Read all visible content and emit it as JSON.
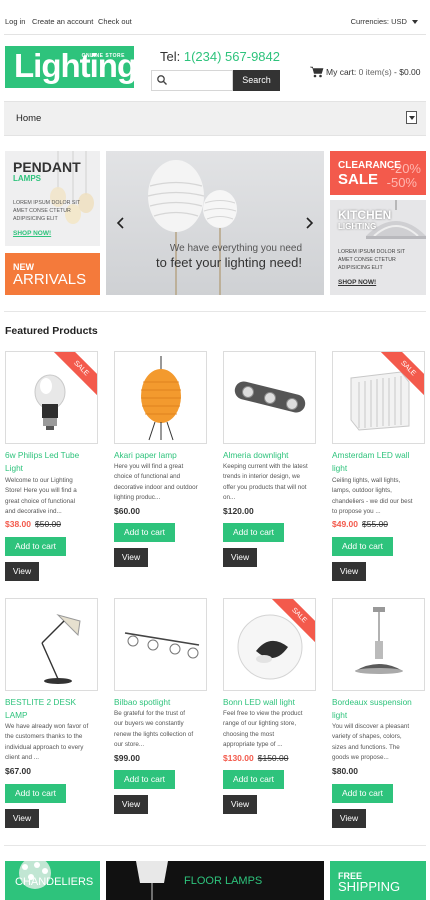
{
  "topbar": {
    "links": [
      "Log in",
      "Create an account",
      "Check out"
    ],
    "currency_label": "Currencies:",
    "currency_value": "USD"
  },
  "header": {
    "logo_text": "Lighting",
    "logo_sub": "ONLINE STORE",
    "tel_label": "Tel:",
    "tel_number": "1(234) 567-9842",
    "search_placeholder": "",
    "search_button": "Search",
    "cart_label": "My cart:",
    "cart_count": "0 item(s)",
    "cart_total": "- $0.00"
  },
  "nav": {
    "home": "Home"
  },
  "banners": {
    "pendant": {
      "title": "PENDANT",
      "subtitle": "LAMPS",
      "text": [
        "LOREM IPSUM DOLOR SIT",
        "AMET CONSE CTETUR",
        "ADIPISICING ELIT"
      ],
      "link": "SHOP NOW!"
    },
    "arrivals": {
      "line1": "NEW",
      "line2": "ARRIVALS"
    },
    "slider": {
      "caption1": "We have everything you need",
      "caption2": "to feet your lighting need!"
    },
    "clearance": {
      "line1": "CLEARANCE",
      "line2": "SALE",
      "pct1": "-20%",
      "pct2": "-50%"
    },
    "kitchen": {
      "title": "KITCHEN",
      "subtitle": "LIGHTING",
      "text": [
        "LOREM IPSUM DOLOR SIT",
        "AMET CONSE CTETUR",
        "ADIPISICING ELIT"
      ],
      "link": "SHOP NOW!"
    }
  },
  "featured": {
    "title": "Featured Products",
    "add_to_cart": "Add to cart",
    "view": "View",
    "sale": "SALE",
    "products": [
      {
        "name": [
          "6w Philips Led Tube",
          "Light"
        ],
        "desc": [
          "Welcome to our Lighting",
          "Store! Here you will find a",
          "great choice of functional",
          "and decorative ind..."
        ],
        "price": "$38.00",
        "old_price": "$50.00",
        "sale": true,
        "icon": "bulb-icon"
      },
      {
        "name": [
          "Akari paper lamp"
        ],
        "desc": [
          "Here you will find a great",
          "choice of functional and",
          "decorative indoor and outdoor",
          "lighting produc..."
        ],
        "price": "$60.00",
        "old_price": "",
        "sale": false,
        "icon": "paper-lamp-icon"
      },
      {
        "name": [
          "Almeria downlight"
        ],
        "desc": [
          "Keeping current with the latest",
          "trends in interior design, we",
          "offer you products that will not",
          "on..."
        ],
        "price": "$120.00",
        "old_price": "",
        "sale": false,
        "icon": "downlight-icon"
      },
      {
        "name": [
          "Amsterdam LED wall",
          "light"
        ],
        "desc": [
          "Ceiling lights, wall lights,",
          "lamps, outdoor lights,",
          "chandeliers - we did our best",
          "to propose you ..."
        ],
        "price": "$49.00",
        "old_price": "$55.00",
        "sale": true,
        "icon": "wall-light-icon"
      },
      {
        "name": [
          "BESTLITE 2 DESK",
          "LAMP"
        ],
        "desc": [
          "We have already won favor of",
          "the customers thanks to the",
          "individual approach to every",
          "client and ..."
        ],
        "price": "$67.00",
        "old_price": "",
        "sale": false,
        "icon": "desk-lamp-icon"
      },
      {
        "name": [
          "Bilbao spotlight"
        ],
        "desc": [
          "Be grateful for the trust of",
          "our buyers we constantly",
          "renew the lights collection of",
          "our store..."
        ],
        "price": "$99.00",
        "old_price": "",
        "sale": false,
        "icon": "spotlight-icon"
      },
      {
        "name": [
          "Bonn LED wall light"
        ],
        "desc": [
          "Feel free to view the product",
          "range of our lighting store,",
          "choosing the most",
          "appropriate type of ..."
        ],
        "price": "$130.00",
        "old_price": "$150.00",
        "sale": true,
        "icon": "globe-wall-light-icon"
      },
      {
        "name": [
          "Bordeaux suspension",
          "light"
        ],
        "desc": [
          "You will discover a pleasant",
          "variety of shapes, colors,",
          "sizes and functions. The",
          "goods we propose..."
        ],
        "price": "$80.00",
        "old_price": "",
        "sale": false,
        "icon": "suspension-light-icon"
      }
    ]
  },
  "bottom_banners": {
    "chandeliers": "CHANDELIERS",
    "floor_lamps": "FLOOR LAMPS",
    "free": "FREE",
    "shipping": "SHIPPING"
  },
  "colors": {
    "accent": "#2ec37c",
    "sale": "#f35a4c",
    "orange": "#f47a3b",
    "dark": "#333333"
  }
}
